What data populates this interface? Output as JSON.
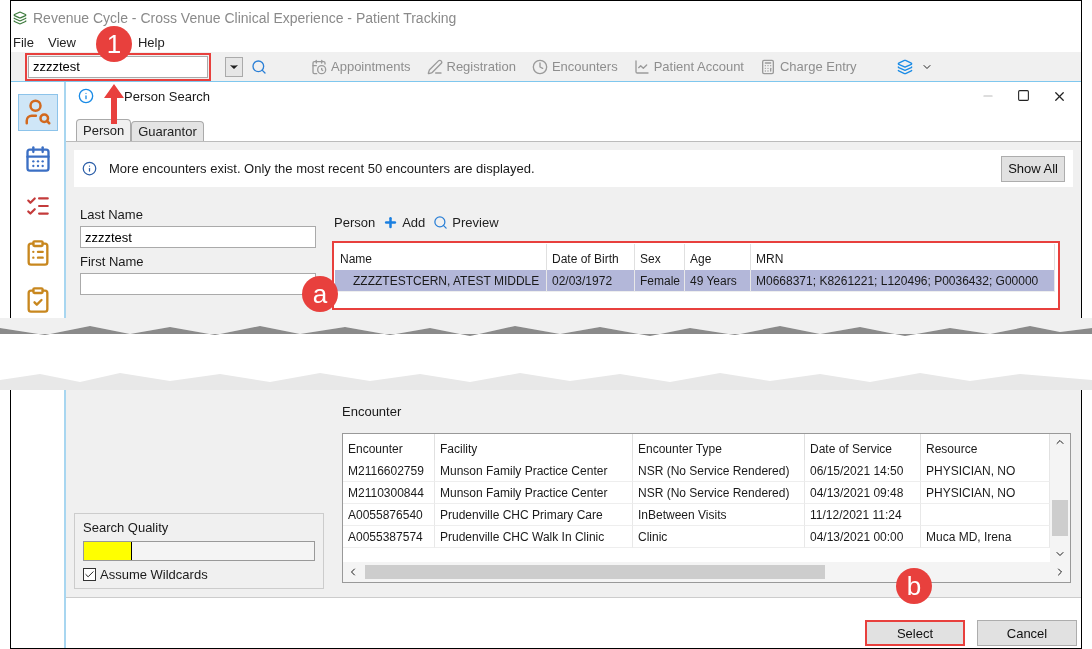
{
  "window": {
    "title": "Revenue Cycle - Cross Venue Clinical Experience - Patient Tracking"
  },
  "menu": [
    "File",
    "View",
    "Help"
  ],
  "toolbar": {
    "search_value": "zzzztest",
    "items": [
      {
        "label": "Appointments",
        "kind": "calendar",
        "disabled": true
      },
      {
        "label": "Registration",
        "kind": "pen",
        "disabled": true
      },
      {
        "label": "Encounters",
        "kind": "clock",
        "disabled": true
      },
      {
        "label": "Patient Account",
        "kind": "chart",
        "disabled": true
      },
      {
        "label": "Charge Entry",
        "kind": "calculator",
        "disabled": true
      }
    ]
  },
  "dialog": {
    "title": "Person Search",
    "tabs": [
      {
        "label": "Person",
        "selected": true
      },
      {
        "label": "Guarantor",
        "selected": false
      }
    ],
    "info": "More encounters exist. Only the most recent 50 encounters are displayed.",
    "show_all": "Show All",
    "fields": [
      {
        "label": "Last Name",
        "value": "zzzztest"
      },
      {
        "label": "First Name"
      }
    ],
    "person_toolbar": {
      "label": "Person",
      "add": "Add",
      "preview": "Preview"
    },
    "person_table": {
      "columns": [
        "Name",
        "Date of Birth",
        "Sex",
        "Age",
        "MRN"
      ],
      "rows": [
        {
          "cells": [
            "ZZZZTESTCERN, ATEST MIDDLE",
            "02/03/1972",
            "Female",
            "49 Years",
            "M0668371; K8261221; L120496; P0036432; G00000"
          ],
          "selected": true
        }
      ]
    },
    "encounter_label": "Encounter",
    "encounter_table": {
      "columns": [
        "Encounter",
        "Facility",
        "Encounter Type",
        "Date of Service",
        "Resource"
      ],
      "rows": [
        {
          "cells": [
            "M2116602759",
            "Munson Family Practice Center",
            "NSR (No Service Rendered)",
            "06/15/2021 14:50",
            "PHYSICIAN, NO"
          ]
        },
        {
          "cells": [
            "M2110300844",
            "Munson Family Practice Center",
            "NSR (No Service Rendered)",
            "04/13/2021 09:48",
            "PHYSICIAN, NO"
          ]
        },
        {
          "cells": [
            "A0055876540",
            "Prudenville CHC Primary Care",
            "InBetween Visits",
            "11/12/2021 11:24",
            null
          ]
        },
        {
          "cells": [
            "A0055387574",
            "Prudenville CHC Walk In Clinic",
            "Clinic",
            "04/13/2021 00:00",
            "Muca MD, Irena"
          ]
        }
      ]
    },
    "search_quality": {
      "label": "Search Quality",
      "level": 0.21
    },
    "assume_wildcards": {
      "label": "Assume Wildcards",
      "checked": true
    },
    "buttons": [
      {
        "label": "Select",
        "highlighted": true
      },
      {
        "label": "Cancel",
        "highlighted": false
      }
    ]
  },
  "annotations": [
    "1",
    "a",
    "b"
  ]
}
